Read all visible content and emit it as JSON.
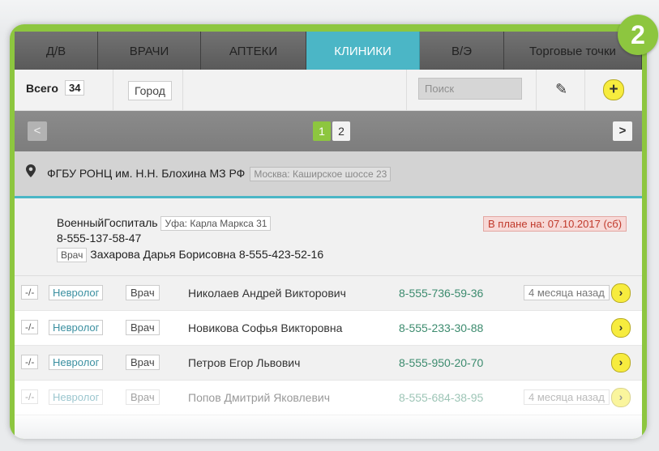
{
  "badge": "2",
  "tabs": [
    {
      "label": "Д/В"
    },
    {
      "label": "ВРАЧИ"
    },
    {
      "label": "АПТЕКИ"
    },
    {
      "label": "КЛИНИКИ",
      "active": true
    },
    {
      "label": "В/Э"
    },
    {
      "label": "Торговые точки"
    }
  ],
  "toolbar": {
    "total_label": "Всего",
    "total_count": "34",
    "city_button": "Город",
    "search_placeholder": "Поиск"
  },
  "pager": {
    "prev": "<",
    "next": ">",
    "pages": [
      "1",
      "2"
    ],
    "current": "1"
  },
  "clinic": {
    "name": "ФГБУ РОНЦ им. Н.Н. Блохина МЗ РФ",
    "address": "Москва: Каширское шоссе 23"
  },
  "sub_clinic": {
    "name": "ВоенныйГоспиталь",
    "address": "Уфа: Карла Маркса 31",
    "phone": "8-555-137-58-47",
    "doctor_role": "Врач",
    "doctor": "Захарова Дарья Борисовна 8-555-423-52-16",
    "plan": "В плане на: 07.10.2017 (сб)"
  },
  "rows": [
    {
      "dash": "-/-",
      "spec": "Невролог",
      "role": "Врач",
      "name": "Николаев Андрей Викторович",
      "phone": "8-555-736-59-36",
      "ago": "4 месяца назад"
    },
    {
      "dash": "-/-",
      "spec": "Невролог",
      "role": "Врач",
      "name": "Новикова Софья Викторовна",
      "phone": "8-555-233-30-88",
      "ago": ""
    },
    {
      "dash": "-/-",
      "spec": "Невролог",
      "role": "Врач",
      "name": "Петров Егор Львович",
      "phone": "8-555-950-20-70",
      "ago": ""
    },
    {
      "dash": "-/-",
      "spec": "Невролог",
      "role": "Врач",
      "name": "Попов Дмитрий Яковлевич",
      "phone": "8-555-684-38-95",
      "ago": "4 месяца назад"
    }
  ],
  "colors": {
    "accent_green": "#8dc63f",
    "active_tab": "#4bb6c6",
    "plan_red": "#c0392b",
    "go_yellow": "#f7ec3e"
  }
}
